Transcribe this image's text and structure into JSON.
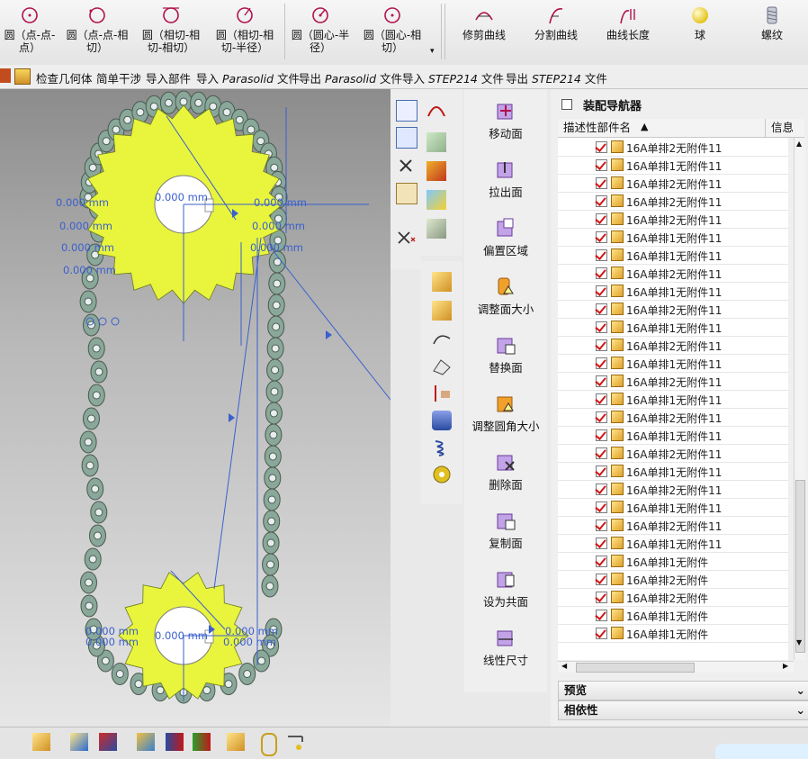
{
  "ribbon": {
    "items": [
      {
        "label": "圆（点-点-\n点）",
        "icon": "circle-three-point-icon"
      },
      {
        "label": "圆（点-点-相\n切）",
        "icon": "circle-point-tangent-icon"
      },
      {
        "label": "圆（相切-相\n切-相切）",
        "icon": "circle-tangent-icon"
      },
      {
        "label": "圆（相切-相\n切-半径）",
        "icon": "circle-tangent-radius-icon"
      },
      {
        "label": "圆（圆心-半\n径）",
        "icon": "circle-center-radius-icon"
      },
      {
        "label": "圆（圆心-相\n切）",
        "icon": "circle-center-tangent-icon"
      },
      {
        "label": "修剪曲线",
        "icon": "trim-curve-icon"
      },
      {
        "label": "分割曲线",
        "icon": "split-curve-icon"
      },
      {
        "label": "曲线长度",
        "icon": "curve-length-icon"
      },
      {
        "label": "球",
        "icon": "sphere-icon"
      },
      {
        "label": "螺纹",
        "icon": "thread-icon"
      }
    ]
  },
  "toolbar2": {
    "check_geometry": "检查几何体",
    "simple_interference": "简单干涉",
    "import_part": "导入部件",
    "import_parasolid_a": "导入",
    "import_parasolid_b": "Parasolid",
    "import_parasolid_c": "文件",
    "export_parasolid_a": "导出",
    "export_parasolid_b": "Parasolid",
    "export_parasolid_c": "文件",
    "import_step_a": "导入",
    "import_step_b": "STEP214",
    "import_step_c": "文件",
    "export_step_a": "导出",
    "export_step_b": "STEP214",
    "export_step_c": "文件"
  },
  "viewport": {
    "dim_labels": [
      "0.000 mm",
      "0.000 mm",
      "0.000 mm",
      "0.000 mm",
      "0.000 mm",
      "0.000 mm",
      "0.000 mm",
      "0.000 mm",
      "0.000 mm",
      "0.000 mm",
      "0.000 mm",
      "0.000 mm",
      "0.000 mm",
      "0.000 mm"
    ],
    "sprocket_color": "#e8f53c",
    "chain_color": "#8aa89a",
    "dimension_color": "#3a5fcf"
  },
  "feature_panel": {
    "items": [
      {
        "label": "移动面",
        "icon": "move-face-icon"
      },
      {
        "label": "拉出面",
        "icon": "pull-face-icon"
      },
      {
        "label": "偏置区域",
        "icon": "offset-region-icon"
      },
      {
        "label": "调整面大小",
        "icon": "resize-face-icon"
      },
      {
        "label": "替换面",
        "icon": "replace-face-icon"
      },
      {
        "label": "调整圆角大小",
        "icon": "resize-blend-icon"
      },
      {
        "label": "删除面",
        "icon": "delete-face-icon"
      },
      {
        "label": "复制面",
        "icon": "copy-face-icon"
      },
      {
        "label": "设为共面",
        "icon": "make-coplanar-icon"
      },
      {
        "label": "线性尺寸",
        "icon": "linear-dimension-icon"
      }
    ]
  },
  "navigator": {
    "title": "装配导航器",
    "col_name": "描述性部件名",
    "col_info": "信息",
    "rows": [
      "16A单排2无附件11",
      "16A单排1无附件11",
      "16A单排2无附件11",
      "16A单排2无附件11",
      "16A单排2无附件11",
      "16A单排1无附件11",
      "16A单排1无附件11",
      "16A单排2无附件11",
      "16A单排1无附件11",
      "16A单排2无附件11",
      "16A单排1无附件11",
      "16A单排2无附件11",
      "16A单排1无附件11",
      "16A单排2无附件11",
      "16A单排1无附件11",
      "16A单排2无附件11",
      "16A单排1无附件11",
      "16A单排2无附件11",
      "16A单排1无附件11",
      "16A单排2无附件11",
      "16A单排1无附件11",
      "16A单排2无附件11",
      "16A单排1无附件11",
      "16A单排1无附件",
      "16A单排2无附件",
      "16A单排2无附件",
      "16A单排1无附件",
      "16A单排1无附件"
    ],
    "preview": "预览",
    "dependencies": "相依性"
  }
}
